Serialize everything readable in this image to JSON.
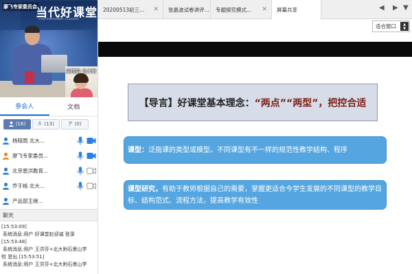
{
  "video": {
    "channel_name": "廖飞专家委员会",
    "banner_title": "当代好课堂",
    "banner_subtitle": "CONTEMPORARY CLASSES",
    "pip_label": "梁桂娟 北大附"
  },
  "panel_tabs": [
    {
      "label": "参会人",
      "active": true
    },
    {
      "label": "文档",
      "active": false
    }
  ],
  "filters": [
    {
      "icon": "user-icon",
      "count": "(16)",
      "active": true
    },
    {
      "icon": "mic-icon",
      "count": "(13)",
      "active": false
    },
    {
      "icon": "flag-icon",
      "count": "(0)",
      "active": false
    }
  ],
  "participants": [
    {
      "name": "杨晓雨 北大...",
      "role": "attendee"
    },
    {
      "name": "廖飞专家委员...",
      "role": "host"
    },
    {
      "name": "北京恩洪教育...",
      "role": "attendee"
    },
    {
      "name": "乔于格 北大...",
      "role": "attendee"
    },
    {
      "name": "产品部王继...",
      "role": "attendee"
    }
  ],
  "chat": {
    "title": "聊天",
    "lines": [
      "[15:53:09]",
      "系统消息:用户 好课堂赵迎诚 登录",
      "[15:53:48]",
      "系统消息:用户 王洪芬+北大附石景山学",
      "校 登出 [15:53:51]",
      "系统消息:用户 王洪芬+北大附石景山学"
    ]
  },
  "doc_tabs": [
    {
      "label": "20200513初三...",
      "active": false
    },
    {
      "label": "张晶波试卷讲评...",
      "active": false
    },
    {
      "label": "专题探究模式...",
      "active": false
    },
    {
      "label": "屏幕共享",
      "active": true
    }
  ],
  "zoom": {
    "value": "适合窗口"
  },
  "slide": {
    "title_prefix": "【导言】好课堂基本理念：",
    "title_highlight": "“两点”“两型”，把控合适",
    "box1": {
      "term": "课型：",
      "text": "泛指课的类型或模型。不同课型有不一样的规范性教学结构、程序"
    },
    "box2": {
      "term": "课型研究，",
      "line1": "有助于教师根据自己的需要，掌握更适合今学生发展的不同课型的教学目",
      "line2": "标、结构范式、流程方法，提高教学有效性"
    }
  },
  "colors": {
    "accent": "#1a6fd6",
    "box_blue": "#55a6e0",
    "title_highlight": "#7a1f14",
    "filter_active": "#5d7db2"
  }
}
